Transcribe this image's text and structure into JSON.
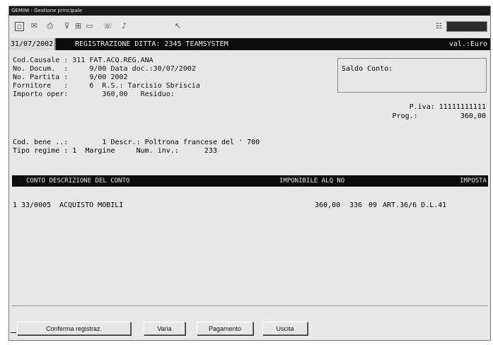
{
  "window": {
    "title": "GEMINI - Gestione principale"
  },
  "toolbar": {
    "icons": [
      "calculator-icon",
      "mail-icon",
      "print-icon",
      "filter-icon",
      "table-icon",
      "monitor-icon",
      "phone-icon",
      "sound-icon",
      "cursor-icon"
    ],
    "right_small": "☷"
  },
  "header": {
    "date": "31/07/2002",
    "title": "REGISTRAZIONE DITTA: 2345 TEAMSYSTEM",
    "valuta": "val.:Euro"
  },
  "form": {
    "line1": "Cod.Causale : 311 FAT.ACQ.REG.ANA",
    "line2": "No. Docum.  :     9/00 Data doc.:30/07/2002",
    "line3": "No. Partita :     9/00 2002",
    "line4": "Fornitore   :     6  R.S.: Tarcisio Sbriscia",
    "line5": "Importo oper:        360,00   Residuo:",
    "saldo_label": "Saldo Conto:",
    "piva": "P.iva: 11111111111",
    "prog": "Prog.:          360,00",
    "cod_bene": "Cod. bene ..:        1 Descr.: Poltrona francese del ' 700",
    "tipo_regime": "Tipo regime : 1  Margine     Num. inv.:      233"
  },
  "table": {
    "headers": {
      "conto": "CONTO DESCRIZIONE DEL CONTO",
      "imponibile": "IMPONIBILE ALQ NO",
      "imposta": "IMPOSTA"
    },
    "rows": [
      {
        "line_no": "1",
        "conto": "33/0005",
        "descrizione": "ACQUISTO MOBILI",
        "imponibile": "360,00",
        "alq": "336",
        "no": "09",
        "note": "ART.36/6 D.L.41"
      }
    ]
  },
  "buttons": {
    "conferma": "Conferma registraz.",
    "varia": "Varia",
    "pagamento": "Pagamento",
    "uscita": "Uscita"
  }
}
